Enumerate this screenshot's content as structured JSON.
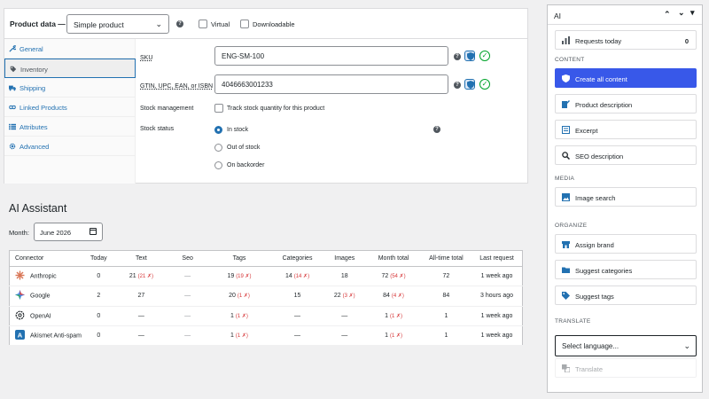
{
  "product_data": {
    "title": "Product data —",
    "type_selected": "Simple product",
    "virtual_label": "Virtual",
    "downloadable_label": "Downloadable",
    "tabs": [
      {
        "label": "General",
        "icon": "wrench-icon"
      },
      {
        "label": "Inventory",
        "icon": "tag-icon",
        "active": true
      },
      {
        "label": "Shipping",
        "icon": "truck-icon"
      },
      {
        "label": "Linked Products",
        "icon": "link-icon"
      },
      {
        "label": "Attributes",
        "icon": "list-icon"
      },
      {
        "label": "Advanced",
        "icon": "gear-icon"
      }
    ],
    "sku_label": "SKU",
    "sku_value": "ENG-SM-100",
    "gtin_label": "GTIN, UPC, EAN, or ISBN",
    "gtin_value": "4046663001233",
    "stock_mgmt_label": "Stock management",
    "stock_mgmt_checkbox": "Track stock quantity for this product",
    "stock_status_label": "Stock status",
    "stock_options": [
      "In stock",
      "Out of stock",
      "On backorder"
    ],
    "stock_selected": "In stock"
  },
  "assistant": {
    "title": "AI Assistant",
    "month_label": "Month:",
    "month_value": "June 2026",
    "columns": [
      "Connector",
      "Today",
      "Text",
      "Seo",
      "Tags",
      "Categories",
      "Images",
      "Month total",
      "All-time total",
      "Last request"
    ],
    "rows": [
      {
        "connector": "Anthropic",
        "icon": "anthropic-logo-icon",
        "today": "0",
        "text": "21",
        "text_x": "(21 ✗)",
        "seo": "—",
        "tags": "19",
        "tags_x": "(19 ✗)",
        "categories": "14",
        "categories_x": "(14 ✗)",
        "images": "18",
        "images_x": "",
        "month_total": "72",
        "month_total_x": "(54 ✗)",
        "all_time": "72",
        "last_request": "1 week ago"
      },
      {
        "connector": "Google",
        "icon": "google-logo-icon",
        "today": "2",
        "text": "27",
        "text_x": "",
        "seo": "—",
        "tags": "20",
        "tags_x": "(1 ✗)",
        "categories": "15",
        "categories_x": "",
        "images": "22",
        "images_x": "(3 ✗)",
        "month_total": "84",
        "month_total_x": "(4 ✗)",
        "all_time": "84",
        "last_request": "3 hours ago"
      },
      {
        "connector": "OpenAI",
        "icon": "openai-logo-icon",
        "today": "0",
        "text": "—",
        "text_x": "",
        "seo": "—",
        "tags": "1",
        "tags_x": "(1 ✗)",
        "categories": "—",
        "categories_x": "",
        "images": "—",
        "images_x": "",
        "month_total": "1",
        "month_total_x": "(1 ✗)",
        "all_time": "1",
        "last_request": "1 week ago"
      },
      {
        "connector": "Akismet Anti-spam",
        "icon": "akismet-logo-icon",
        "today": "0",
        "text": "—",
        "text_x": "",
        "seo": "—",
        "tags": "1",
        "tags_x": "(1 ✗)",
        "categories": "—",
        "categories_x": "",
        "images": "—",
        "images_x": "",
        "month_total": "1",
        "month_total_x": "(1 ✗)",
        "all_time": "1",
        "last_request": "1 week ago"
      }
    ]
  },
  "ai_panel": {
    "title": "AI",
    "requests_label": "Requests today",
    "requests_count": "0",
    "content_heading": "CONTENT",
    "create_all": "Create all content",
    "product_description": "Product description",
    "excerpt": "Excerpt",
    "seo_description": "SEO description",
    "media_heading": "MEDIA",
    "image_search": "Image search",
    "organize_heading": "ORGANIZE",
    "assign_brand": "Assign brand",
    "suggest_categories": "Suggest categories",
    "suggest_tags": "Suggest tags",
    "translate_heading": "TRANSLATE",
    "select_language": "Select language...",
    "translate_button": "Translate"
  },
  "colors": {
    "accent": "#2271b1",
    "primary_button": "#3858e9",
    "error": "#d63638",
    "success": "#00a32a"
  }
}
